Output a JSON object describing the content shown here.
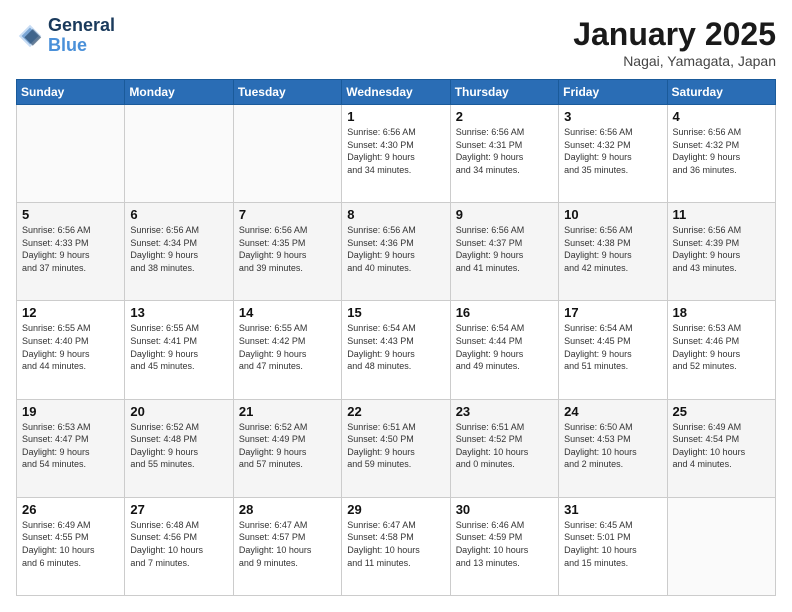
{
  "header": {
    "logo_line1": "General",
    "logo_line2": "Blue",
    "title": "January 2025",
    "subtitle": "Nagai, Yamagata, Japan"
  },
  "weekdays": [
    "Sunday",
    "Monday",
    "Tuesday",
    "Wednesday",
    "Thursday",
    "Friday",
    "Saturday"
  ],
  "weeks": [
    [
      {
        "day": "",
        "info": ""
      },
      {
        "day": "",
        "info": ""
      },
      {
        "day": "",
        "info": ""
      },
      {
        "day": "1",
        "info": "Sunrise: 6:56 AM\nSunset: 4:30 PM\nDaylight: 9 hours\nand 34 minutes."
      },
      {
        "day": "2",
        "info": "Sunrise: 6:56 AM\nSunset: 4:31 PM\nDaylight: 9 hours\nand 34 minutes."
      },
      {
        "day": "3",
        "info": "Sunrise: 6:56 AM\nSunset: 4:32 PM\nDaylight: 9 hours\nand 35 minutes."
      },
      {
        "day": "4",
        "info": "Sunrise: 6:56 AM\nSunset: 4:32 PM\nDaylight: 9 hours\nand 36 minutes."
      }
    ],
    [
      {
        "day": "5",
        "info": "Sunrise: 6:56 AM\nSunset: 4:33 PM\nDaylight: 9 hours\nand 37 minutes."
      },
      {
        "day": "6",
        "info": "Sunrise: 6:56 AM\nSunset: 4:34 PM\nDaylight: 9 hours\nand 38 minutes."
      },
      {
        "day": "7",
        "info": "Sunrise: 6:56 AM\nSunset: 4:35 PM\nDaylight: 9 hours\nand 39 minutes."
      },
      {
        "day": "8",
        "info": "Sunrise: 6:56 AM\nSunset: 4:36 PM\nDaylight: 9 hours\nand 40 minutes."
      },
      {
        "day": "9",
        "info": "Sunrise: 6:56 AM\nSunset: 4:37 PM\nDaylight: 9 hours\nand 41 minutes."
      },
      {
        "day": "10",
        "info": "Sunrise: 6:56 AM\nSunset: 4:38 PM\nDaylight: 9 hours\nand 42 minutes."
      },
      {
        "day": "11",
        "info": "Sunrise: 6:56 AM\nSunset: 4:39 PM\nDaylight: 9 hours\nand 43 minutes."
      }
    ],
    [
      {
        "day": "12",
        "info": "Sunrise: 6:55 AM\nSunset: 4:40 PM\nDaylight: 9 hours\nand 44 minutes."
      },
      {
        "day": "13",
        "info": "Sunrise: 6:55 AM\nSunset: 4:41 PM\nDaylight: 9 hours\nand 45 minutes."
      },
      {
        "day": "14",
        "info": "Sunrise: 6:55 AM\nSunset: 4:42 PM\nDaylight: 9 hours\nand 47 minutes."
      },
      {
        "day": "15",
        "info": "Sunrise: 6:54 AM\nSunset: 4:43 PM\nDaylight: 9 hours\nand 48 minutes."
      },
      {
        "day": "16",
        "info": "Sunrise: 6:54 AM\nSunset: 4:44 PM\nDaylight: 9 hours\nand 49 minutes."
      },
      {
        "day": "17",
        "info": "Sunrise: 6:54 AM\nSunset: 4:45 PM\nDaylight: 9 hours\nand 51 minutes."
      },
      {
        "day": "18",
        "info": "Sunrise: 6:53 AM\nSunset: 4:46 PM\nDaylight: 9 hours\nand 52 minutes."
      }
    ],
    [
      {
        "day": "19",
        "info": "Sunrise: 6:53 AM\nSunset: 4:47 PM\nDaylight: 9 hours\nand 54 minutes."
      },
      {
        "day": "20",
        "info": "Sunrise: 6:52 AM\nSunset: 4:48 PM\nDaylight: 9 hours\nand 55 minutes."
      },
      {
        "day": "21",
        "info": "Sunrise: 6:52 AM\nSunset: 4:49 PM\nDaylight: 9 hours\nand 57 minutes."
      },
      {
        "day": "22",
        "info": "Sunrise: 6:51 AM\nSunset: 4:50 PM\nDaylight: 9 hours\nand 59 minutes."
      },
      {
        "day": "23",
        "info": "Sunrise: 6:51 AM\nSunset: 4:52 PM\nDaylight: 10 hours\nand 0 minutes."
      },
      {
        "day": "24",
        "info": "Sunrise: 6:50 AM\nSunset: 4:53 PM\nDaylight: 10 hours\nand 2 minutes."
      },
      {
        "day": "25",
        "info": "Sunrise: 6:49 AM\nSunset: 4:54 PM\nDaylight: 10 hours\nand 4 minutes."
      }
    ],
    [
      {
        "day": "26",
        "info": "Sunrise: 6:49 AM\nSunset: 4:55 PM\nDaylight: 10 hours\nand 6 minutes."
      },
      {
        "day": "27",
        "info": "Sunrise: 6:48 AM\nSunset: 4:56 PM\nDaylight: 10 hours\nand 7 minutes."
      },
      {
        "day": "28",
        "info": "Sunrise: 6:47 AM\nSunset: 4:57 PM\nDaylight: 10 hours\nand 9 minutes."
      },
      {
        "day": "29",
        "info": "Sunrise: 6:47 AM\nSunset: 4:58 PM\nDaylight: 10 hours\nand 11 minutes."
      },
      {
        "day": "30",
        "info": "Sunrise: 6:46 AM\nSunset: 4:59 PM\nDaylight: 10 hours\nand 13 minutes."
      },
      {
        "day": "31",
        "info": "Sunrise: 6:45 AM\nSunset: 5:01 PM\nDaylight: 10 hours\nand 15 minutes."
      },
      {
        "day": "",
        "info": ""
      }
    ]
  ]
}
